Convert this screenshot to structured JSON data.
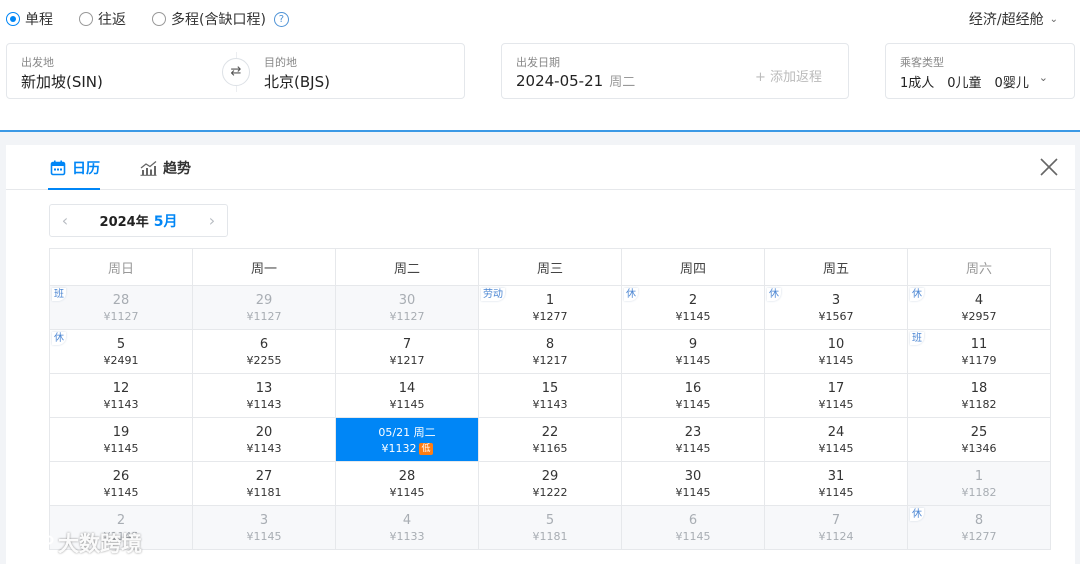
{
  "trip_types": [
    {
      "label": "单程",
      "selected": true
    },
    {
      "label": "往返",
      "selected": false
    },
    {
      "label": "多程(含缺口程)",
      "selected": false
    }
  ],
  "help_icon": "?",
  "cabin": {
    "label": "经济/超经舱"
  },
  "route": {
    "from_label": "出发地",
    "from_value": "新加坡(SIN)",
    "to_label": "目的地",
    "to_value": "北京(BJS)"
  },
  "date": {
    "label": "出发日期",
    "value": "2024-05-21",
    "weekday": "周二",
    "add_return": "+ 添加返程"
  },
  "passengers": {
    "label": "乘客类型",
    "value": "1成人　0儿童　0婴儿"
  },
  "tabs": {
    "calendar": "日历",
    "trend": "趋势"
  },
  "month_nav": {
    "year": "2024年",
    "month": "5月"
  },
  "weekdays": [
    "周日",
    "周一",
    "周二",
    "周三",
    "周四",
    "周五",
    "周六"
  ],
  "weeks": [
    [
      {
        "day": "28",
        "price": "¥1127",
        "out": true,
        "tag": "班"
      },
      {
        "day": "29",
        "price": "¥1127",
        "out": true
      },
      {
        "day": "30",
        "price": "¥1127",
        "out": true
      },
      {
        "day": "1",
        "price": "¥1277",
        "tag": "劳动"
      },
      {
        "day": "2",
        "price": "¥1145",
        "tag": "休"
      },
      {
        "day": "3",
        "price": "¥1567",
        "tag": "休"
      },
      {
        "day": "4",
        "price": "¥2957",
        "tag": "休"
      }
    ],
    [
      {
        "day": "5",
        "price": "¥2491",
        "tag": "休"
      },
      {
        "day": "6",
        "price": "¥2255"
      },
      {
        "day": "7",
        "price": "¥1217"
      },
      {
        "day": "8",
        "price": "¥1217"
      },
      {
        "day": "9",
        "price": "¥1145"
      },
      {
        "day": "10",
        "price": "¥1145"
      },
      {
        "day": "11",
        "price": "¥1179",
        "tag": "班"
      }
    ],
    [
      {
        "day": "12",
        "price": "¥1143"
      },
      {
        "day": "13",
        "price": "¥1143"
      },
      {
        "day": "14",
        "price": "¥1145"
      },
      {
        "day": "15",
        "price": "¥1143"
      },
      {
        "day": "16",
        "price": "¥1145"
      },
      {
        "day": "17",
        "price": "¥1145"
      },
      {
        "day": "18",
        "price": "¥1182"
      }
    ],
    [
      {
        "day": "19",
        "price": "¥1145"
      },
      {
        "day": "20",
        "price": "¥1143"
      },
      {
        "day": "05/21 周二",
        "price": "¥1132",
        "selected": true,
        "badge": "低"
      },
      {
        "day": "22",
        "price": "¥1165"
      },
      {
        "day": "23",
        "price": "¥1145"
      },
      {
        "day": "24",
        "price": "¥1145"
      },
      {
        "day": "25",
        "price": "¥1346"
      }
    ],
    [
      {
        "day": "26",
        "price": "¥1145"
      },
      {
        "day": "27",
        "price": "¥1181"
      },
      {
        "day": "28",
        "price": "¥1145"
      },
      {
        "day": "29",
        "price": "¥1222"
      },
      {
        "day": "30",
        "price": "¥1145"
      },
      {
        "day": "31",
        "price": "¥1145"
      },
      {
        "day": "1",
        "price": "¥1182",
        "out": true
      }
    ],
    [
      {
        "day": "2",
        "price": "¥1145",
        "out": true
      },
      {
        "day": "3",
        "price": "¥1145",
        "out": true
      },
      {
        "day": "4",
        "price": "¥1133",
        "out": true
      },
      {
        "day": "5",
        "price": "¥1181",
        "out": true
      },
      {
        "day": "6",
        "price": "¥1145",
        "out": true
      },
      {
        "day": "7",
        "price": "¥1124",
        "out": true
      },
      {
        "day": "8",
        "price": "¥1277",
        "out": true,
        "tag": "休"
      }
    ]
  ],
  "watermark": "大数跨境",
  "colors": {
    "accent": "#0086f6",
    "low_badge": "#ff7d13",
    "tag_text": "#4a85d2"
  }
}
